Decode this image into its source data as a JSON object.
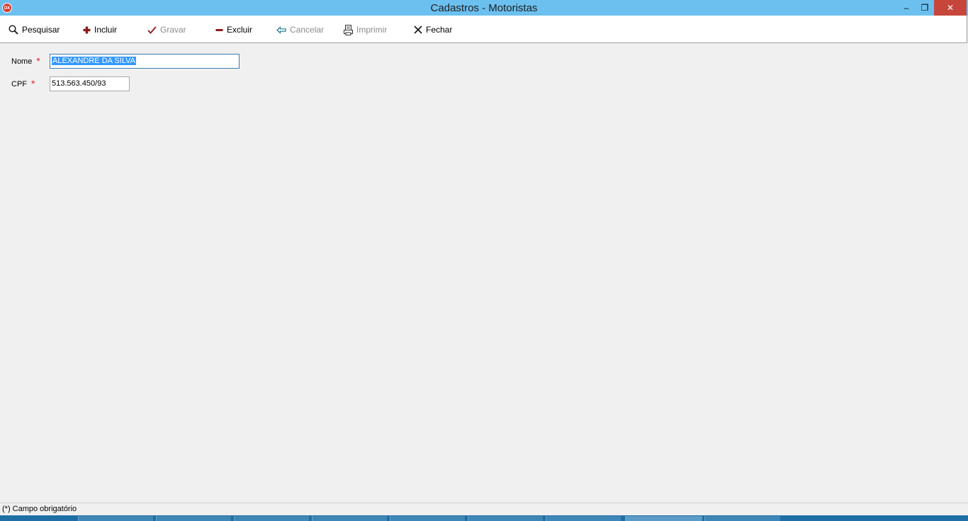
{
  "window": {
    "title": "Cadastros - Motoristas",
    "app_icon_text": "DX",
    "controls": {
      "minimize": "–",
      "restore": "❐",
      "close": "✕"
    }
  },
  "toolbar": {
    "pesquisar": "Pesquisar",
    "incluir": "Incluir",
    "gravar": "Gravar",
    "excluir": "Excluir",
    "cancelar": "Cancelar",
    "imprimir": "Imprimir",
    "fechar": "Fechar"
  },
  "form": {
    "nome": {
      "label": "Nome",
      "required_mark": "*",
      "value": "ALEXANDRE DA SILVA"
    },
    "cpf": {
      "label": "CPF",
      "required_mark": "*",
      "value": "513.563.450/93"
    }
  },
  "status": {
    "text": "(*) Campo obrigatório"
  },
  "colors": {
    "titlebar": "#6cc0ef",
    "close_button": "#c7463b",
    "required": "#e0202a",
    "selection": "#3399ff",
    "taskbar": "#1d6fa5"
  }
}
